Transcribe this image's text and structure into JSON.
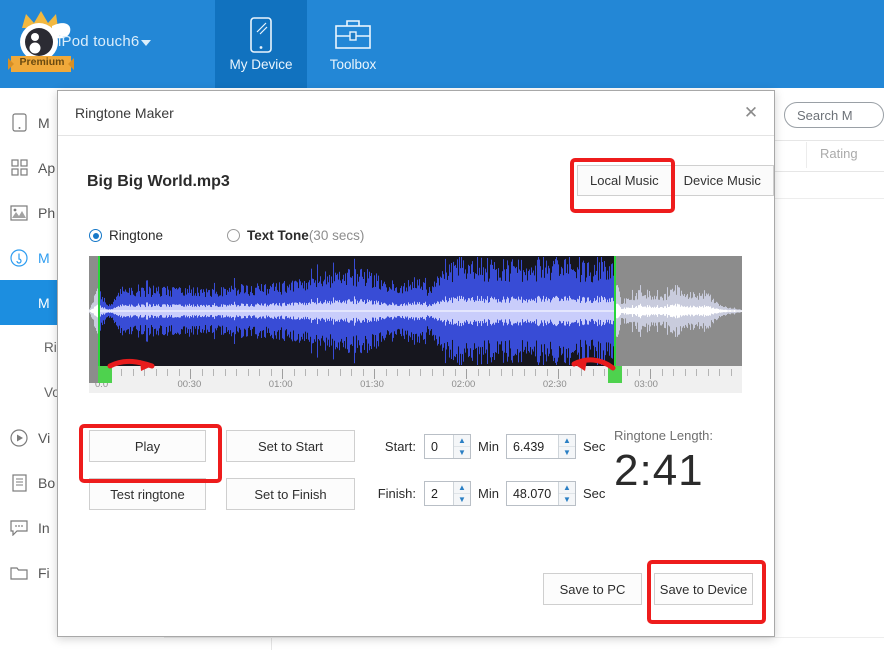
{
  "app": {
    "device_name": "iPod touch6",
    "premium_badge": "Premium",
    "nav_tabs": [
      {
        "label": "My Device",
        "icon": "phone-icon",
        "active": true
      },
      {
        "label": "Toolbox",
        "icon": "toolbox-icon",
        "active": false
      }
    ]
  },
  "sidebar": {
    "items": [
      {
        "label": "M",
        "icon": "phone-icon",
        "state": "normal"
      },
      {
        "label": "Ap",
        "icon": "apps-grid-icon",
        "state": "normal"
      },
      {
        "label": "Ph",
        "icon": "photo-icon",
        "state": "normal"
      },
      {
        "label": "M",
        "icon": "music-disc-icon",
        "state": "highlight"
      },
      {
        "label": "M",
        "icon": "",
        "state": "active"
      },
      {
        "label": "Ri",
        "icon": "",
        "state": "sub"
      },
      {
        "label": "Vo",
        "icon": "",
        "state": "sub"
      },
      {
        "label": "Vi",
        "icon": "video-play-icon",
        "state": "normal"
      },
      {
        "label": "Bo",
        "icon": "book-icon",
        "state": "normal"
      },
      {
        "label": "In",
        "icon": "message-icon",
        "state": "normal"
      },
      {
        "label": "Fi",
        "icon": "folder-icon",
        "state": "normal"
      }
    ]
  },
  "content": {
    "search_placeholder": "Search M",
    "column_rating": "Rating"
  },
  "dialog": {
    "title": "Ringtone Maker",
    "close_label": "✕",
    "song_title": "Big Big World.mp3",
    "source_buttons": [
      {
        "label": "Local Music",
        "selected": true
      },
      {
        "label": "Device Music",
        "selected": false
      }
    ],
    "tone_options": [
      {
        "label": "Ringtone",
        "selected": true
      },
      {
        "label": "Text Tone",
        "suffix": "(30 secs)",
        "selected": false
      }
    ],
    "buttons": {
      "play": "Play",
      "test_ringtone": "Test ringtone",
      "set_to_start": "Set to Start",
      "set_to_finish": "Set to Finish",
      "save_to_pc": "Save to PC",
      "save_to_device": "Save to Device"
    },
    "start": {
      "label": "Start:",
      "min_value": "0",
      "min_unit": "Min",
      "sec_value": "6.439",
      "sec_unit": "Sec"
    },
    "finish": {
      "label": "Finish:",
      "min_value": "2",
      "min_unit": "Min",
      "sec_value": "48.070",
      "sec_unit": "Sec"
    },
    "ringtone_length": {
      "label": "Ringtone Length:",
      "value": "2:41"
    },
    "timeline": {
      "labels": [
        "0:0",
        "00:30",
        "01:00",
        "01:30",
        "02:00",
        "02:30",
        "03:00"
      ],
      "selection_start": "0:06",
      "selection_end": "2:48"
    }
  },
  "colors": {
    "brand_blue": "#2387d6",
    "tab_active_blue": "#1172bf",
    "sidebar_active": "#1c8ee0",
    "highlight_red": "#ee1c1c",
    "marker_green": "#29d63a",
    "waveform_blue": "#3a52e8"
  }
}
